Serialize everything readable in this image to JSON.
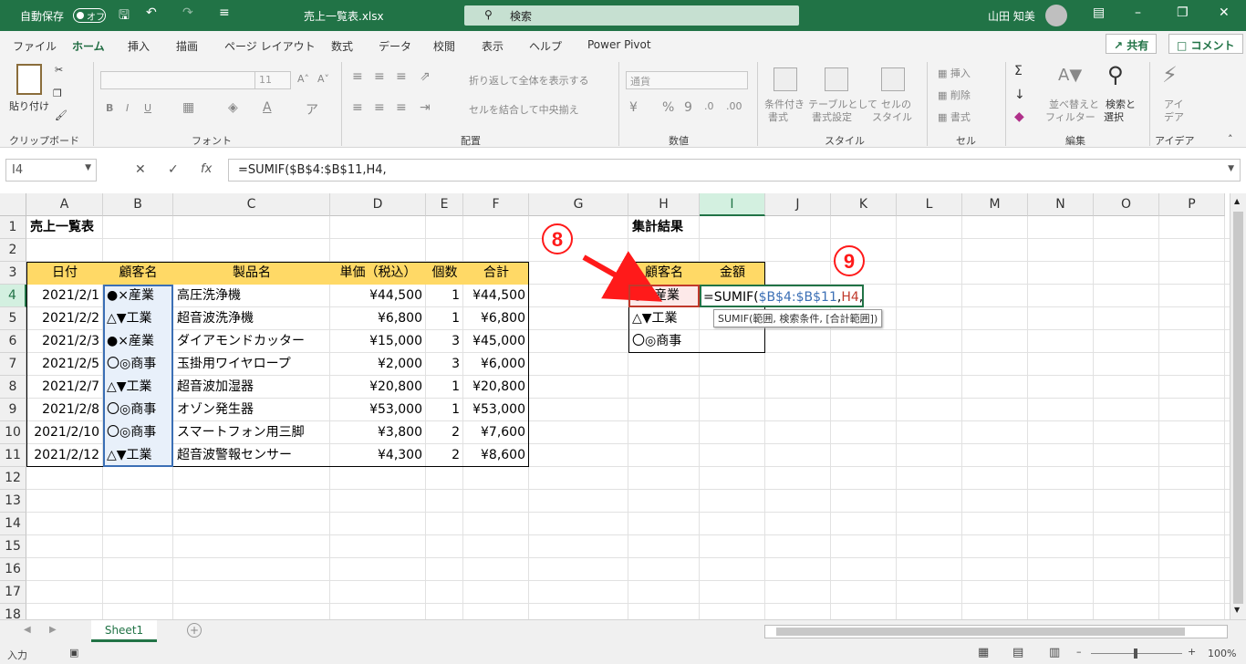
{
  "titlebar": {
    "autosave_label": "自動保存",
    "autosave_state": "オフ",
    "file_name": "売上一覧表.xlsx",
    "search_placeholder": "検索",
    "user_name": "山田 知美"
  },
  "menu": {
    "tabs": [
      "ファイル",
      "ホーム",
      "挿入",
      "描画",
      "ページ レイアウト",
      "数式",
      "データ",
      "校閲",
      "表示",
      "ヘルプ",
      "Power Pivot"
    ],
    "active_tab": "ホーム",
    "share_label": "共有",
    "comment_label": "コメント"
  },
  "ribbon": {
    "paste_label": "貼り付け",
    "group_clipboard": "クリップボード",
    "group_font": "フォント",
    "font_size": "11",
    "group_alignment": "配置",
    "wrap_text": "折り返して全体を表示する",
    "merge_center": "セルを結合して中央揃え",
    "number_format": "通貨",
    "group_number": "数値",
    "cond_format_1": "条件付き",
    "cond_format_2": "書式",
    "table_format_1": "テーブルとして",
    "table_format_2": "書式設定",
    "cell_style_1": "セルの",
    "cell_style_2": "スタイル",
    "group_style": "スタイル",
    "insert": "挿入",
    "delete": "削除",
    "format": "書式",
    "group_cells": "セル",
    "sort_1": "並べ替えと",
    "sort_2": "フィルター",
    "find_1": "検索と",
    "find_2": "選択",
    "group_edit": "編集",
    "idea_1": "アイ",
    "idea_2": "デア",
    "group_idea": "アイデア"
  },
  "formula_bar": {
    "name_box": "I4",
    "formula": "=SUMIF($B$4:$B$11,H4,"
  },
  "grid": {
    "columns": [
      "A",
      "B",
      "C",
      "D",
      "E",
      "F",
      "G",
      "H",
      "I",
      "J",
      "K",
      "L",
      "M",
      "N",
      "O",
      "P"
    ],
    "rows": [
      "1",
      "2",
      "3",
      "4",
      "5",
      "6",
      "7",
      "8",
      "9",
      "10",
      "11",
      "12",
      "13",
      "14",
      "15",
      "16",
      "17",
      "18"
    ],
    "title": "売上一覧表",
    "headers": [
      "日付",
      "顧客名",
      "製品名",
      "単価（税込）",
      "個数",
      "合計"
    ],
    "data": [
      [
        "2021/2/1",
        "●×産業",
        "高圧洗浄機",
        "¥44,500",
        "1",
        "¥44,500"
      ],
      [
        "2021/2/2",
        "△▼工業",
        "超音波洗浄機",
        "¥6,800",
        "1",
        "¥6,800"
      ],
      [
        "2021/2/3",
        "●×産業",
        "ダイアモンドカッター",
        "¥15,000",
        "3",
        "¥45,000"
      ],
      [
        "2021/2/5",
        "〇◎商事",
        "玉掛用ワイヤロープ",
        "¥2,000",
        "3",
        "¥6,000"
      ],
      [
        "2021/2/7",
        "△▼工業",
        "超音波加湿器",
        "¥20,800",
        "1",
        "¥20,800"
      ],
      [
        "2021/2/8",
        "〇◎商事",
        "オゾン発生器",
        "¥53,000",
        "1",
        "¥53,000"
      ],
      [
        "2021/2/10",
        "〇◎商事",
        "スマートフォン用三脚",
        "¥3,800",
        "2",
        "¥7,600"
      ],
      [
        "2021/2/12",
        "△▼工業",
        "超音波警報センサー",
        "¥4,300",
        "2",
        "¥8,600"
      ]
    ],
    "summary_title": "集計結果",
    "summary_headers": [
      "顧客名",
      "金額"
    ],
    "summary_customers": [
      "●×産業",
      "△▼工業",
      "〇◎商事"
    ],
    "edit_prefix": "=SUMIF(",
    "edit_range": "$B$4:$B$11",
    "edit_comma": ",",
    "edit_ref": "H4",
    "edit_trail": ",",
    "tooltip": "SUMIF(範囲, 検索条件, [合計範囲])"
  },
  "annotations": {
    "step8": "8",
    "step9": "9",
    "accent": "#ff0000"
  },
  "sheets": [
    "Sheet1"
  ],
  "status": {
    "mode": "入力",
    "zoom": "100%"
  }
}
